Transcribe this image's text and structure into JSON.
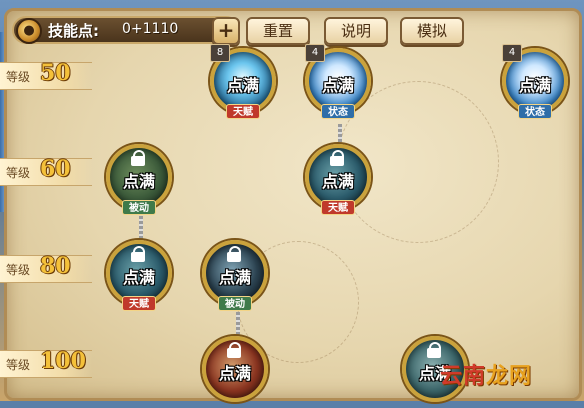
{
  "header": {
    "skill_points_label": "技能点:",
    "skill_points_value": "0+1110",
    "plus_label": "+",
    "reset_label": "重置",
    "help_label": "说明",
    "simulate_label": "模拟"
  },
  "levels": [
    {
      "word": "等级",
      "value": "50"
    },
    {
      "word": "等级",
      "value": "60"
    },
    {
      "word": "等级",
      "value": "80"
    },
    {
      "word": "等级",
      "value": "100"
    }
  ],
  "skills": [
    {
      "max_text": "点满",
      "tag": "天赋",
      "badge": "8",
      "style": "blue-burst"
    },
    {
      "max_text": "点满",
      "tag": "状态",
      "badge": "4",
      "style": "white-burst"
    },
    {
      "max_text": "点满",
      "tag": "状态",
      "badge": "4",
      "style": "white-burst"
    },
    {
      "max_text": "点满",
      "tag": "被动",
      "badge": "",
      "style": "green-locked"
    },
    {
      "max_text": "点满",
      "tag": "天赋",
      "badge": "",
      "style": "teal-locked"
    },
    {
      "max_text": "点满",
      "tag": "天赋",
      "badge": "",
      "style": "teal-locked"
    },
    {
      "max_text": "点满",
      "tag": "被动",
      "badge": "",
      "style": "dark-locked"
    },
    {
      "max_text": "点满",
      "tag": "",
      "badge": "",
      "style": "red-partial"
    },
    {
      "max_text": "点满",
      "tag": "",
      "badge": "",
      "style": "teal-partial"
    }
  ],
  "tag_colors": {
    "天赋": "#c0392b",
    "状态": "#2f6ea8",
    "被动": "#3f7a4a"
  },
  "watermark": {
    "part1": "云南",
    "part2": "龙网"
  }
}
